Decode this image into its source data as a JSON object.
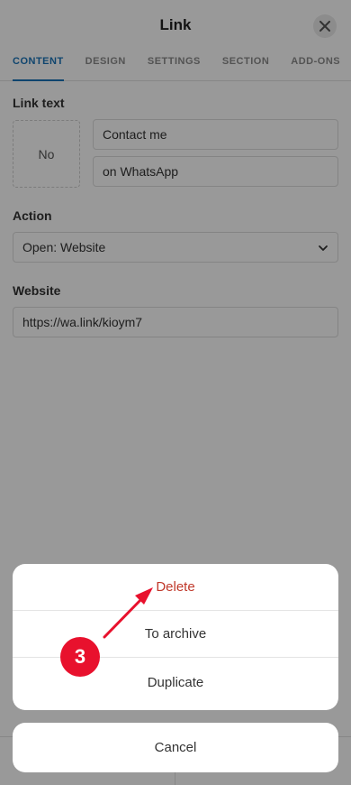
{
  "header": {
    "title": "Link",
    "close_icon": "close-icon"
  },
  "tabs": [
    {
      "label": "CONTENT",
      "active": true
    },
    {
      "label": "DESIGN",
      "active": false
    },
    {
      "label": "SETTINGS",
      "active": false
    },
    {
      "label": "SECTION",
      "active": false
    },
    {
      "label": "ADD-ONS",
      "active": false
    }
  ],
  "link_text": {
    "label": "Link text",
    "icon_placeholder": "No",
    "line1": "Contact me",
    "line2": "on WhatsApp"
  },
  "action": {
    "label": "Action",
    "selected": "Open: Website",
    "chevron_icon": "chevron-down-icon"
  },
  "website": {
    "label": "Website",
    "value": "https://wa.link/kioym7"
  },
  "action_sheet": {
    "items": [
      "Delete",
      "To archive",
      "Duplicate"
    ],
    "cancel": "Cancel",
    "danger_color": "#c0392b"
  },
  "annotation": {
    "step_number": "3",
    "color": "#e8112d"
  }
}
